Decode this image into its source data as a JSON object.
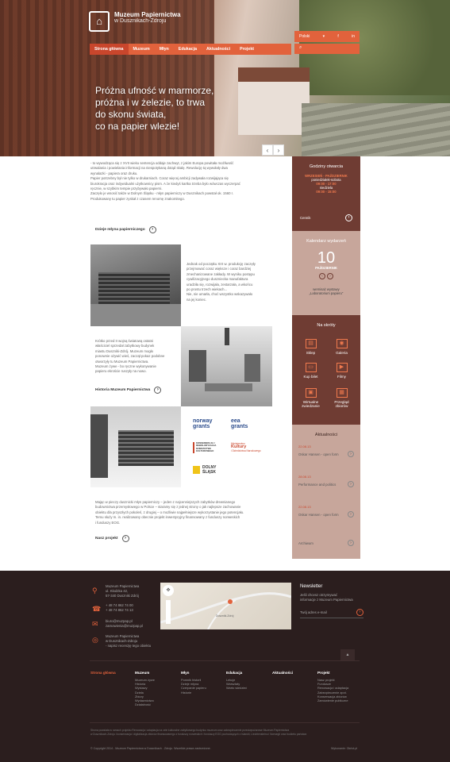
{
  "header": {
    "logo_line1": "Muzeum Papiernictwa",
    "logo_line2": "w Dusznikach-Zdroju",
    "lang": "Polski",
    "lang_caret": "▾",
    "social": [
      "f",
      "in"
    ],
    "nav": [
      "Strona główna",
      "Muzeum",
      "Młyn",
      "Edukacja",
      "Aktualności",
      "Projekt"
    ],
    "headline_lines": [
      "Próżna ufność w marmorze,",
      "próżna i w żelezie, to trwa",
      "do skonu świata,",
      "co na papier wlezie!"
    ],
    "prev": "‹",
    "next": "›"
  },
  "intro": {
    "text_lines": [
      "- to wywodząca się z XVII wieku sentencja oddaje zachwyt, z jakim Europa powitała możliwość",
      "utrwalania i powielania informacji na niespotykaną dotąd skalę. Rewolucję tą wywołały dwa",
      "wynalazki - papiera oraz druku.",
      "Papier potrzebny był nie tylko w drukarniach. Coraz więcej ambicji zadywała rozwijająca się",
      "biurokracja oraz indywidualni użytkownicy pism. A że kiedyś kartka trzeba było wówczas wyczerpać",
      "ręcznie, w szybkim tempie przybywało papierni.",
      "Zaczęło je wnosić także w Dolnym Śląsku - młyn papierniczy w Dusznikach powstał ok. 1560 r.",
      "Produkowany tu papier zyskał z czasem renomę znakomitego."
    ],
    "link": "Dzieje młyna papierniczego",
    "arrow": "›"
  },
  "block1": {
    "text_lines": [
      "Jednak od początku XIX w. produkcję zaczęły",
      "przejmować coraz większe i coraz bardziej",
      "zmechanizowane zakłady. W wyniku postępu",
      "cywilizacyjnego duszniecka manufaktura",
      "uradziła się, rozwijała, zestarzała, a wkońcu",
      "po prostu trzech wiekach...",
      "Nie, nie umarła, choć wszystko wskazywało",
      "na jej koniec."
    ]
  },
  "block2": {
    "text_lines": [
      "Krótko przed II wojną światową ostatni",
      "właściciel sprzedał zabytkowy budynek",
      "miastu Duszniki-Zdrój. Muzeum mogło",
      "ponownie ożywić wieś, zaczął pokaz podobne",
      "otworzyły tu Muzeum Papiernictwa.",
      "Muzeum żywe - bo ręczne wykonywanie",
      "papieru ekroście ruszyły na nowo."
    ],
    "link": "Historia Muzeum Papiernictwa"
  },
  "partners": {
    "norway": [
      "norway",
      "grants"
    ],
    "eea": [
      "eea",
      "grants"
    ],
    "konserwacja": "KONSERWACJA I REWALORYZACJA DZIEDZICTWA KULTUROWEGO",
    "min1": "Ministerstwo",
    "min2": "Kultury",
    "min3": "i Dziedzictwa Narodowego",
    "ds1": "DOLNY",
    "ds2": "ŚLĄSK"
  },
  "project": {
    "text_lines": [
      "Mając w pieczy dusznicki młyn papierniczy – jeden z najcenniejszych zabytków drewnianego",
      "budownictwa przemysłowego w Polsce – staramy się z jednej strony o jak najlepsze zachowanie",
      "obiektu dla przyszłych pokoleń, z drugiej – o możliwie najpełniejsze wykorzystanie jego potencjału.",
      "Temu służy m. in. realizowany obecnie projekt inwestycyjny finansowany z funduszy norweskich",
      "i funduszy EOG."
    ],
    "link": "Nasz projekt"
  },
  "sidebar": {
    "hours": {
      "title": "Godziny otwarcia",
      "season": "WRZESIEŃ - PAŹDZIERNIK",
      "days1": "poniedziałek-sobota",
      "time1": "09:00 - 17:00",
      "days2": "niedziela",
      "time2": "09:00 - 15:00",
      "link": "Cennik"
    },
    "calendar": {
      "title": "Kalendarz wydarzeń",
      "day": "10",
      "month": "PAŹDZIERNIK",
      "event1": "wernisaż wystawy",
      "event2": "„Laboratorium papieru\""
    },
    "shortcuts": {
      "title": "Na skróty",
      "items": [
        {
          "label": "Sklep",
          "icon": "shop-icon",
          "glyph": "▤"
        },
        {
          "label": "Galeria",
          "icon": "camera-icon",
          "glyph": "◉"
        },
        {
          "label": "Kup bilet",
          "icon": "ticket-icon",
          "glyph": "▭"
        },
        {
          "label": "Filmy",
          "icon": "play-icon",
          "glyph": "▶"
        },
        {
          "label": "Wirtualne zwiedzanie",
          "icon": "monitor-icon",
          "glyph": "▣"
        },
        {
          "label": "Przegląd zbiorów",
          "icon": "folder-icon",
          "glyph": "▦"
        }
      ]
    },
    "news": {
      "title": "Aktualności",
      "items": [
        {
          "date": "22.08.13",
          "title": "Oskar Hansen - open form"
        },
        {
          "date": "28.08.13",
          "title": "Performance and politics"
        },
        {
          "date": "22.08.13",
          "title": "Oskar Hansen - open form"
        }
      ],
      "link": "Archiwum"
    }
  },
  "contact": {
    "address": [
      "Muzeum Papiernictwa",
      "ul. Kłodzka 42,",
      "57-340 Duszniki Zdrój"
    ],
    "phones": [
      "+ 48 74 862 74 00",
      "+ 48 74 862 74 13"
    ],
    "emails": [
      "biuro@muzpap.pl",
      "zamowienia@muzpap.pl"
    ],
    "ta": [
      "Muzeum Papiernictwa",
      "w Dusznikach-Zdroju",
      "- napisz recenzję tego obiektu"
    ],
    "map_labels": [
      "Duszniki-Zdrój"
    ]
  },
  "newsletter": {
    "title": "Newsletter",
    "text": [
      "Jeśli chcesz otrzymywać",
      "informacje z Muzeum Papiernictwa"
    ],
    "placeholder": "Twój adres e-mail",
    "up": "▲"
  },
  "footer_nav": [
    {
      "title": "Strona główna",
      "items": []
    },
    {
      "title": "Muzeum",
      "items": [
        "Muzeum żywe",
        "Historia",
        "Wystawy",
        "Dzieła",
        "Zbiory",
        "Wydawnictwo",
        "Działalność"
      ]
    },
    {
      "title": "Młyn",
      "items": [
        "Pomnik historii",
        "Dzieje młyna",
        "Czerpanie papieru",
        "Historie"
      ]
    },
    {
      "title": "Edukacja",
      "items": [
        "Lekcje",
        "Warsztaty",
        "Warto wiedzieć"
      ]
    },
    {
      "title": "Aktualności",
      "items": []
    },
    {
      "title": "Projekt",
      "items": [
        "Nasz projekt",
        "Fundusze",
        "Renowacja i adaptacja",
        "Zabezpieczenie zpot.",
        "Konserwacja zbiorów",
        "Zamówienie publiczne"
      ]
    }
  ],
  "legal": [
    "Strona powstała w ramach projektu Renowacja i adaptacja na cele kulturalne zabytkowego budynku muzeum oraz zabezpieczenie przeciwpożarowe Muzeum Papiernictwa",
    "w Dusznikach-Zdroju i konserwacja i digitalizacja zbiorów finansowanego z funduszy norweskich i funduszy EOG pochodzących z Islandii, Liechtensteinu i Norwegii oraz budżetu państwa"
  ],
  "copyright": "© Copyright 2014 - Muzeum Papiernictwa w Dusznikach - Zdroju. Wszelkie prawa zastrzeżone.",
  "credit": "Wykonanie: Okrlot.pl",
  "colors": {
    "accent": "#e2623c",
    "brown": "#6f3c33",
    "rose": "#c7a69b",
    "footer": "#2b1e1e"
  }
}
